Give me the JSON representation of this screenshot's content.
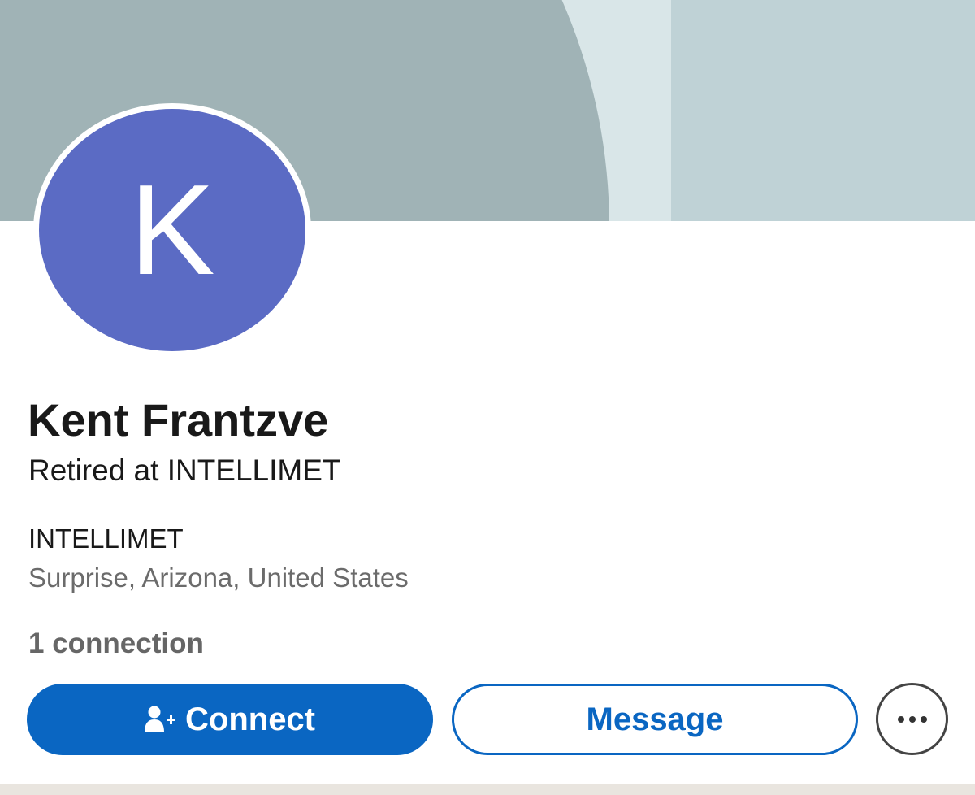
{
  "profile": {
    "initial": "K",
    "name": "Kent Frantzve",
    "headline": "Retired at INTELLIMET",
    "company": "INTELLIMET",
    "location": "Surprise, Arizona, United States",
    "connections": "1 connection"
  },
  "actions": {
    "connect_label": "Connect",
    "connect_icon": "person-add-icon",
    "message_label": "Message",
    "more_icon": "more-horizontal-icon"
  },
  "colors": {
    "primary": "#0a66c2",
    "avatar_bg": "#5b6bc4",
    "banner_dark": "#a0b3b6",
    "banner_light": "#bfd2d6"
  }
}
